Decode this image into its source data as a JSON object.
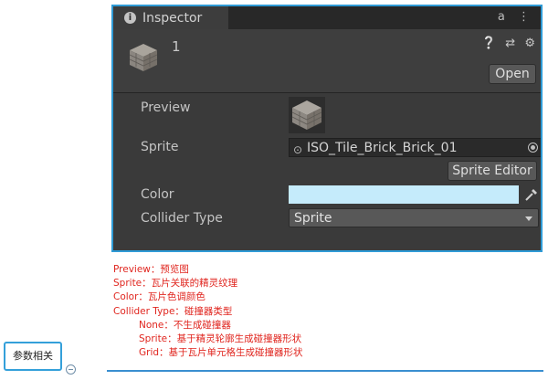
{
  "inspector": {
    "tab_title": "Inspector",
    "tab_info_icon": "i",
    "tab_tools": [
      "a",
      "⋮"
    ],
    "asset_name": "1",
    "header_icons": [
      "help-icon",
      "preset-icon",
      "gear-icon"
    ],
    "open_label": "Open",
    "properties": {
      "preview_label": "Preview",
      "sprite_label": "Sprite",
      "sprite_value": "ISO_Tile_Brick_Brick_01",
      "sprite_editor_label": "Sprite Editor",
      "color_label": "Color",
      "color_value": "#c5ebfb",
      "collider_type_label": "Collider Type",
      "collider_type_value": "Sprite"
    }
  },
  "notes": [
    "Preview：预览图",
    "Sprite：瓦片关联的精灵纹理",
    "Color：瓦片色调颜色",
    "Collider Type：碰撞器类型",
    "None：不生成碰撞器",
    "Sprite：基于精灵轮廓生成碰撞器形状",
    "Grid：基于瓦片单元格生成碰撞器形状"
  ],
  "param_button_label": "参数相关",
  "colors": {
    "accent": "#2f9bd6",
    "note_text": "#e0261f",
    "panel_bg": "#3a3a3a"
  }
}
